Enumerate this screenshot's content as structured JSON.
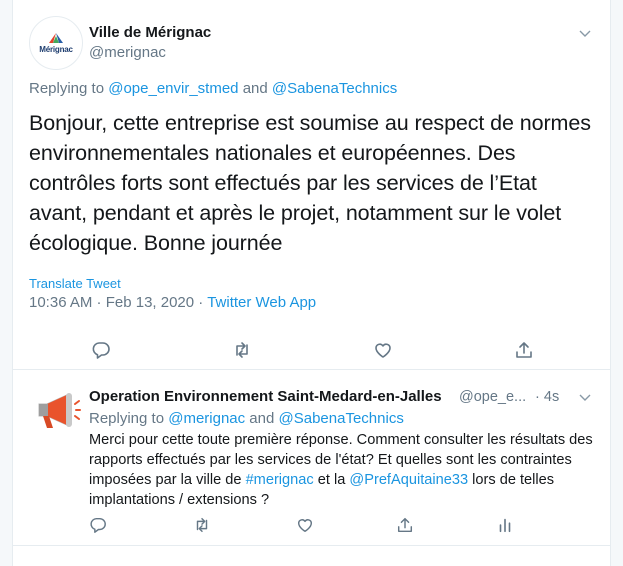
{
  "main_tweet": {
    "author_name": "Ville de Mérignac",
    "author_handle": "@merignac",
    "avatar_logo_text": "Mérignac",
    "replying_prefix": "Replying to ",
    "replying_user_1": "@ope_envir_stmed",
    "replying_and": " and ",
    "replying_user_2": "@SabenaTechnics",
    "text": "Bonjour, cette entreprise est soumise au respect de normes environnementales nationales et européennes. Des contrôles forts sont effectués par les services de l’Etat avant, pendant et après le projet, notamment sur le volet écologique. Bonne journée",
    "translate_label": "Translate Tweet",
    "timestamp": "10:36 AM · Feb 13, 2020",
    "separator": " · ",
    "source_app": "Twitter Web App",
    "icons": [
      "reply-icon",
      "retweet-icon",
      "like-icon",
      "share-icon"
    ]
  },
  "reply_tweet": {
    "author_name": "Operation Environnement Saint-Medard-en-Jalles",
    "author_handle": "@ope_e...",
    "dot": "·",
    "time": "4s",
    "replying_prefix": "Replying to ",
    "replying_user_1": "@merignac",
    "replying_and": " and ",
    "replying_user_2": "@SabenaTechnics",
    "text_part_1": "Merci pour cette toute première réponse. Comment consulter les résultats des rapports effectués par les services de l'état? Et quelles sont les contraintes imposées par la ville de ",
    "hashtag": "#merignac",
    "text_part_2": " et la ",
    "mention": "@PrefAquitaine33",
    "text_part_3": " lors de telles implantations / extensions ?",
    "icons": [
      "reply-icon",
      "retweet-icon",
      "like-icon",
      "share-icon",
      "analytics-icon"
    ]
  },
  "colors": {
    "link": "#1b95e0",
    "text": "#14171a",
    "secondary": "#657786",
    "border": "#e6ecf0"
  }
}
